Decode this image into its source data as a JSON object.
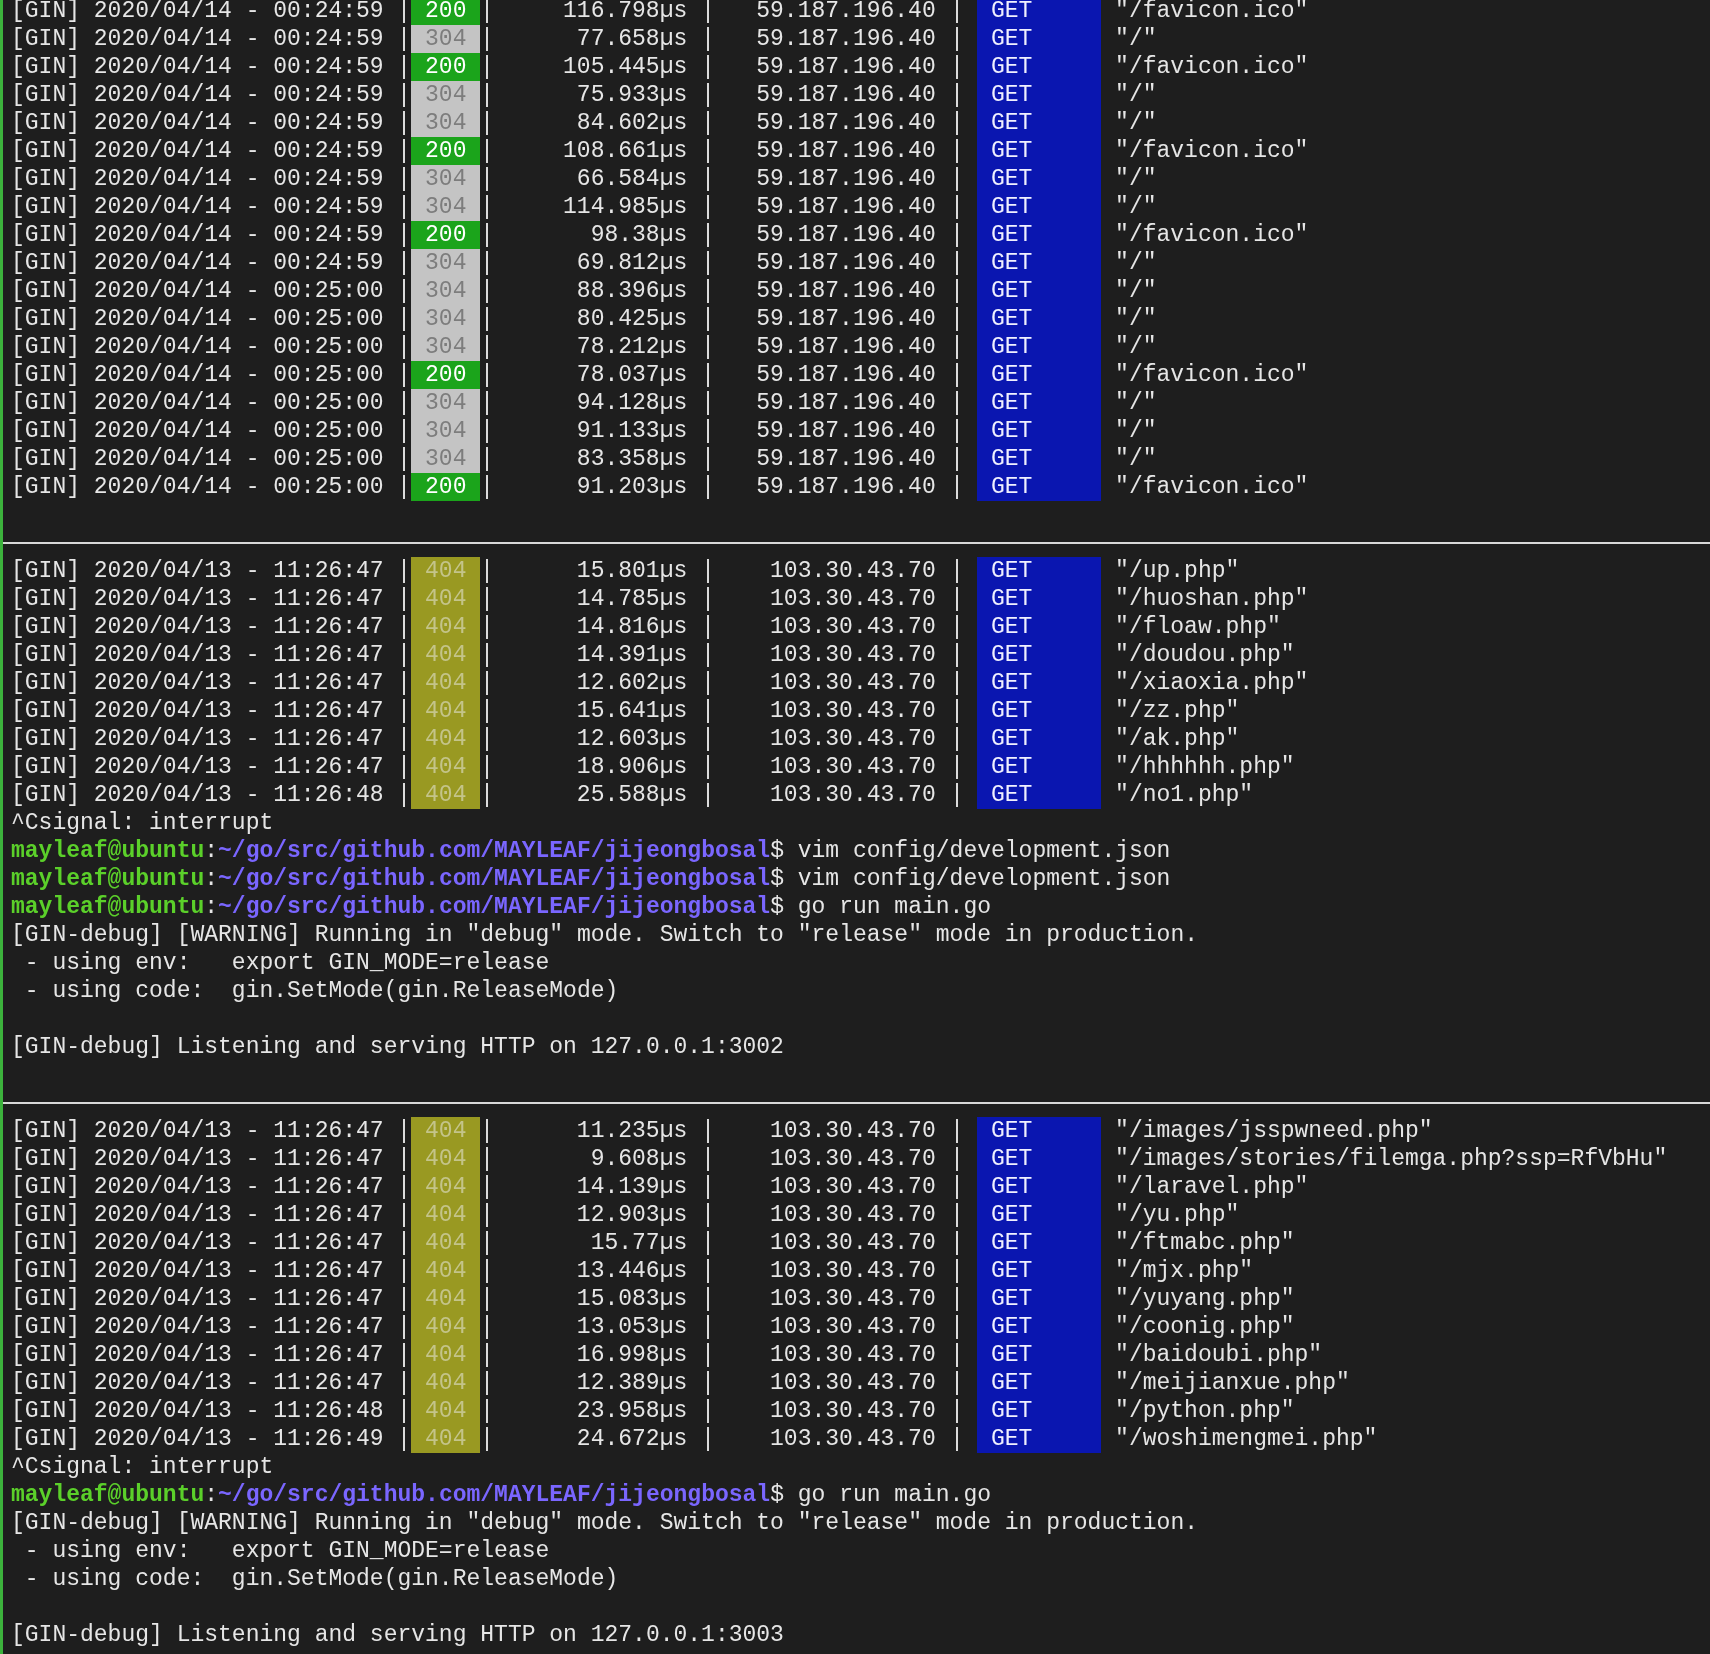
{
  "terminal": {
    "lines": [
      {
        "kind": "log",
        "prefix": "[GIN] 2020/04/14 - 00:24:59",
        "status": {
          "code": "200",
          "kind": "ok"
        },
        "latency": "116.798µs",
        "ip": "59.187.196.40",
        "method": "GET",
        "path": "\"/favicon.ico\""
      },
      {
        "kind": "log",
        "prefix": "[GIN] 2020/04/14 - 00:24:59",
        "status": {
          "code": "304",
          "kind": "not_modified"
        },
        "latency": "77.658µs",
        "ip": "59.187.196.40",
        "method": "GET",
        "path": "\"/\""
      },
      {
        "kind": "log",
        "prefix": "[GIN] 2020/04/14 - 00:24:59",
        "status": {
          "code": "200",
          "kind": "ok"
        },
        "latency": "105.445µs",
        "ip": "59.187.196.40",
        "method": "GET",
        "path": "\"/favicon.ico\""
      },
      {
        "kind": "log",
        "prefix": "[GIN] 2020/04/14 - 00:24:59",
        "status": {
          "code": "304",
          "kind": "not_modified"
        },
        "latency": "75.933µs",
        "ip": "59.187.196.40",
        "method": "GET",
        "path": "\"/\""
      },
      {
        "kind": "log",
        "prefix": "[GIN] 2020/04/14 - 00:24:59",
        "status": {
          "code": "304",
          "kind": "not_modified"
        },
        "latency": "84.602µs",
        "ip": "59.187.196.40",
        "method": "GET",
        "path": "\"/\""
      },
      {
        "kind": "log",
        "prefix": "[GIN] 2020/04/14 - 00:24:59",
        "status": {
          "code": "200",
          "kind": "ok"
        },
        "latency": "108.661µs",
        "ip": "59.187.196.40",
        "method": "GET",
        "path": "\"/favicon.ico\""
      },
      {
        "kind": "log",
        "prefix": "[GIN] 2020/04/14 - 00:24:59",
        "status": {
          "code": "304",
          "kind": "not_modified"
        },
        "latency": "66.584µs",
        "ip": "59.187.196.40",
        "method": "GET",
        "path": "\"/\""
      },
      {
        "kind": "log",
        "prefix": "[GIN] 2020/04/14 - 00:24:59",
        "status": {
          "code": "304",
          "kind": "not_modified"
        },
        "latency": "114.985µs",
        "ip": "59.187.196.40",
        "method": "GET",
        "path": "\"/\""
      },
      {
        "kind": "log",
        "prefix": "[GIN] 2020/04/14 - 00:24:59",
        "status": {
          "code": "200",
          "kind": "ok"
        },
        "latency": "98.38µs",
        "ip": "59.187.196.40",
        "method": "GET",
        "path": "\"/favicon.ico\""
      },
      {
        "kind": "log",
        "prefix": "[GIN] 2020/04/14 - 00:24:59",
        "status": {
          "code": "304",
          "kind": "not_modified"
        },
        "latency": "69.812µs",
        "ip": "59.187.196.40",
        "method": "GET",
        "path": "\"/\""
      },
      {
        "kind": "log",
        "prefix": "[GIN] 2020/04/14 - 00:25:00",
        "status": {
          "code": "304",
          "kind": "not_modified"
        },
        "latency": "88.396µs",
        "ip": "59.187.196.40",
        "method": "GET",
        "path": "\"/\""
      },
      {
        "kind": "log",
        "prefix": "[GIN] 2020/04/14 - 00:25:00",
        "status": {
          "code": "304",
          "kind": "not_modified"
        },
        "latency": "80.425µs",
        "ip": "59.187.196.40",
        "method": "GET",
        "path": "\"/\""
      },
      {
        "kind": "log",
        "prefix": "[GIN] 2020/04/14 - 00:25:00",
        "status": {
          "code": "304",
          "kind": "not_modified"
        },
        "latency": "78.212µs",
        "ip": "59.187.196.40",
        "method": "GET",
        "path": "\"/\""
      },
      {
        "kind": "log",
        "prefix": "[GIN] 2020/04/14 - 00:25:00",
        "status": {
          "code": "200",
          "kind": "ok"
        },
        "latency": "78.037µs",
        "ip": "59.187.196.40",
        "method": "GET",
        "path": "\"/favicon.ico\""
      },
      {
        "kind": "log",
        "prefix": "[GIN] 2020/04/14 - 00:25:00",
        "status": {
          "code": "304",
          "kind": "not_modified"
        },
        "latency": "94.128µs",
        "ip": "59.187.196.40",
        "method": "GET",
        "path": "\"/\""
      },
      {
        "kind": "log",
        "prefix": "[GIN] 2020/04/14 - 00:25:00",
        "status": {
          "code": "304",
          "kind": "not_modified"
        },
        "latency": "91.133µs",
        "ip": "59.187.196.40",
        "method": "GET",
        "path": "\"/\""
      },
      {
        "kind": "log",
        "prefix": "[GIN] 2020/04/14 - 00:25:00",
        "status": {
          "code": "304",
          "kind": "not_modified"
        },
        "latency": "83.358µs",
        "ip": "59.187.196.40",
        "method": "GET",
        "path": "\"/\""
      },
      {
        "kind": "log",
        "prefix": "[GIN] 2020/04/14 - 00:25:00",
        "status": {
          "code": "200",
          "kind": "ok"
        },
        "latency": "91.203µs",
        "ip": "59.187.196.40",
        "method": "GET",
        "path": "\"/favicon.ico\""
      },
      {
        "kind": "blank"
      },
      {
        "kind": "rule"
      },
      {
        "kind": "log",
        "prefix": "[GIN] 2020/04/13 - 11:26:47",
        "status": {
          "code": "404",
          "kind": "not_found"
        },
        "latency": "15.801µs",
        "ip": "103.30.43.70",
        "method": "GET",
        "path": "\"/up.php\""
      },
      {
        "kind": "log",
        "prefix": "[GIN] 2020/04/13 - 11:26:47",
        "status": {
          "code": "404",
          "kind": "not_found"
        },
        "latency": "14.785µs",
        "ip": "103.30.43.70",
        "method": "GET",
        "path": "\"/huoshan.php\""
      },
      {
        "kind": "log",
        "prefix": "[GIN] 2020/04/13 - 11:26:47",
        "status": {
          "code": "404",
          "kind": "not_found"
        },
        "latency": "14.816µs",
        "ip": "103.30.43.70",
        "method": "GET",
        "path": "\"/floaw.php\""
      },
      {
        "kind": "log",
        "prefix": "[GIN] 2020/04/13 - 11:26:47",
        "status": {
          "code": "404",
          "kind": "not_found"
        },
        "latency": "14.391µs",
        "ip": "103.30.43.70",
        "method": "GET",
        "path": "\"/doudou.php\""
      },
      {
        "kind": "log",
        "prefix": "[GIN] 2020/04/13 - 11:26:47",
        "status": {
          "code": "404",
          "kind": "not_found"
        },
        "latency": "12.602µs",
        "ip": "103.30.43.70",
        "method": "GET",
        "path": "\"/xiaoxia.php\""
      },
      {
        "kind": "log",
        "prefix": "[GIN] 2020/04/13 - 11:26:47",
        "status": {
          "code": "404",
          "kind": "not_found"
        },
        "latency": "15.641µs",
        "ip": "103.30.43.70",
        "method": "GET",
        "path": "\"/zz.php\""
      },
      {
        "kind": "log",
        "prefix": "[GIN] 2020/04/13 - 11:26:47",
        "status": {
          "code": "404",
          "kind": "not_found"
        },
        "latency": "12.603µs",
        "ip": "103.30.43.70",
        "method": "GET",
        "path": "\"/ak.php\""
      },
      {
        "kind": "log",
        "prefix": "[GIN] 2020/04/13 - 11:26:47",
        "status": {
          "code": "404",
          "kind": "not_found"
        },
        "latency": "18.906µs",
        "ip": "103.30.43.70",
        "method": "GET",
        "path": "\"/hhhhhh.php\""
      },
      {
        "kind": "log",
        "prefix": "[GIN] 2020/04/13 - 11:26:48",
        "status": {
          "code": "404",
          "kind": "not_found"
        },
        "latency": "25.588µs",
        "ip": "103.30.43.70",
        "method": "GET",
        "path": "\"/no1.php\""
      },
      {
        "kind": "text",
        "text": "^Csignal: interrupt"
      },
      {
        "kind": "prompt",
        "user": "mayleaf@ubuntu",
        "colon": ":",
        "path": "~/go/src/github.com/MAYLEAF/jijeongbosal",
        "symbol": "$",
        "command": "vim config/development.json"
      },
      {
        "kind": "prompt",
        "user": "mayleaf@ubuntu",
        "colon": ":",
        "path": "~/go/src/github.com/MAYLEAF/jijeongbosal",
        "symbol": "$",
        "command": "vim config/development.json"
      },
      {
        "kind": "prompt",
        "user": "mayleaf@ubuntu",
        "colon": ":",
        "path": "~/go/src/github.com/MAYLEAF/jijeongbosal",
        "symbol": "$",
        "command": "go run main.go"
      },
      {
        "kind": "text",
        "text": "[GIN-debug] [WARNING] Running in \"debug\" mode. Switch to \"release\" mode in production."
      },
      {
        "kind": "text",
        "text": " - using env:   export GIN_MODE=release"
      },
      {
        "kind": "text",
        "text": " - using code:  gin.SetMode(gin.ReleaseMode)"
      },
      {
        "kind": "blank"
      },
      {
        "kind": "text",
        "text": "[GIN-debug] Listening and serving HTTP on 127.0.0.1:3002"
      },
      {
        "kind": "blank"
      },
      {
        "kind": "rule"
      },
      {
        "kind": "log",
        "prefix": "[GIN] 2020/04/13 - 11:26:47",
        "status": {
          "code": "404",
          "kind": "not_found"
        },
        "latency": "11.235µs",
        "ip": "103.30.43.70",
        "method": "GET",
        "path": "\"/images/jsspwneed.php\""
      },
      {
        "kind": "log",
        "prefix": "[GIN] 2020/04/13 - 11:26:47",
        "status": {
          "code": "404",
          "kind": "not_found"
        },
        "latency": "9.608µs",
        "ip": "103.30.43.70",
        "method": "GET",
        "path": "\"/images/stories/filemga.php?ssp=RfVbHu\""
      },
      {
        "kind": "log",
        "prefix": "[GIN] 2020/04/13 - 11:26:47",
        "status": {
          "code": "404",
          "kind": "not_found"
        },
        "latency": "14.139µs",
        "ip": "103.30.43.70",
        "method": "GET",
        "path": "\"/laravel.php\""
      },
      {
        "kind": "log",
        "prefix": "[GIN] 2020/04/13 - 11:26:47",
        "status": {
          "code": "404",
          "kind": "not_found"
        },
        "latency": "12.903µs",
        "ip": "103.30.43.70",
        "method": "GET",
        "path": "\"/yu.php\""
      },
      {
        "kind": "log",
        "prefix": "[GIN] 2020/04/13 - 11:26:47",
        "status": {
          "code": "404",
          "kind": "not_found"
        },
        "latency": "15.77µs",
        "ip": "103.30.43.70",
        "method": "GET",
        "path": "\"/ftmabc.php\""
      },
      {
        "kind": "log",
        "prefix": "[GIN] 2020/04/13 - 11:26:47",
        "status": {
          "code": "404",
          "kind": "not_found"
        },
        "latency": "13.446µs",
        "ip": "103.30.43.70",
        "method": "GET",
        "path": "\"/mjx.php\""
      },
      {
        "kind": "log",
        "prefix": "[GIN] 2020/04/13 - 11:26:47",
        "status": {
          "code": "404",
          "kind": "not_found"
        },
        "latency": "15.083µs",
        "ip": "103.30.43.70",
        "method": "GET",
        "path": "\"/yuyang.php\""
      },
      {
        "kind": "log",
        "prefix": "[GIN] 2020/04/13 - 11:26:47",
        "status": {
          "code": "404",
          "kind": "not_found"
        },
        "latency": "13.053µs",
        "ip": "103.30.43.70",
        "method": "GET",
        "path": "\"/coonig.php\""
      },
      {
        "kind": "log",
        "prefix": "[GIN] 2020/04/13 - 11:26:47",
        "status": {
          "code": "404",
          "kind": "not_found"
        },
        "latency": "16.998µs",
        "ip": "103.30.43.70",
        "method": "GET",
        "path": "\"/baidoubi.php\""
      },
      {
        "kind": "log",
        "prefix": "[GIN] 2020/04/13 - 11:26:47",
        "status": {
          "code": "404",
          "kind": "not_found"
        },
        "latency": "12.389µs",
        "ip": "103.30.43.70",
        "method": "GET",
        "path": "\"/meijianxue.php\""
      },
      {
        "kind": "log",
        "prefix": "[GIN] 2020/04/13 - 11:26:48",
        "status": {
          "code": "404",
          "kind": "not_found"
        },
        "latency": "23.958µs",
        "ip": "103.30.43.70",
        "method": "GET",
        "path": "\"/python.php\""
      },
      {
        "kind": "log",
        "prefix": "[GIN] 2020/04/13 - 11:26:49",
        "status": {
          "code": "404",
          "kind": "not_found"
        },
        "latency": "24.672µs",
        "ip": "103.30.43.70",
        "method": "GET",
        "path": "\"/woshimengmei.php\""
      },
      {
        "kind": "text",
        "text": "^Csignal: interrupt"
      },
      {
        "kind": "prompt",
        "user": "mayleaf@ubuntu",
        "colon": ":",
        "path": "~/go/src/github.com/MAYLEAF/jijeongbosal",
        "symbol": "$",
        "command": "go run main.go"
      },
      {
        "kind": "text",
        "text": "[GIN-debug] [WARNING] Running in \"debug\" mode. Switch to \"release\" mode in production."
      },
      {
        "kind": "text",
        "text": " - using env:   export GIN_MODE=release"
      },
      {
        "kind": "text",
        "text": " - using code:  gin.SetMode(gin.ReleaseMode)"
      },
      {
        "kind": "blank"
      },
      {
        "kind": "text",
        "text": "[GIN-debug] Listening and serving HTTP on 127.0.0.1:3003"
      }
    ]
  }
}
